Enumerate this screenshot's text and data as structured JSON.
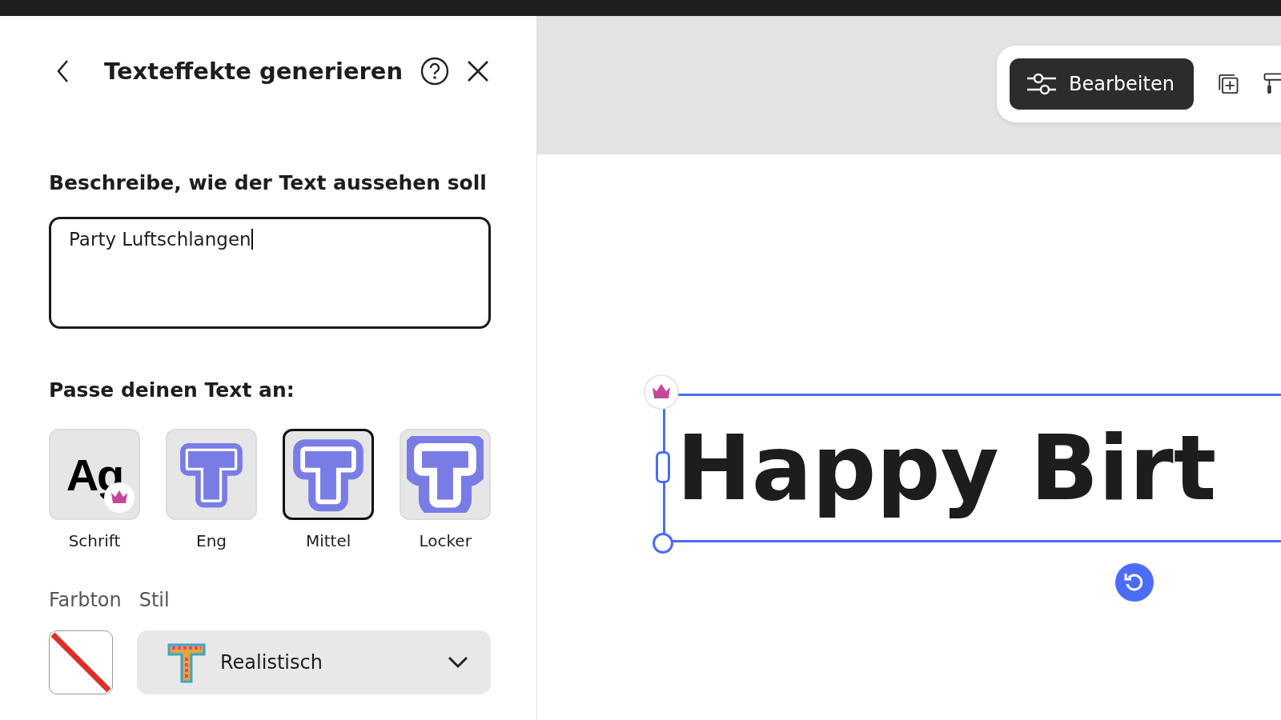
{
  "panel": {
    "title": "Texteffekte generieren",
    "prompt_label": "Beschreibe, wie der Text aussehen soll",
    "prompt": {
      "value": "Party Luftschlangen"
    },
    "adjust_label": "Passe deinen Text an:",
    "shapes": [
      {
        "kind": "font",
        "sample": "Ag",
        "label": "Schrift",
        "selected": false,
        "premium": true
      },
      {
        "kind": "tight",
        "label": "Eng",
        "selected": false
      },
      {
        "kind": "medium",
        "label": "Mittel",
        "selected": true
      },
      {
        "kind": "loose",
        "label": "Locker",
        "selected": false
      }
    ],
    "color_label": "Farbton",
    "style_label": "Stil",
    "color": {
      "none": true
    },
    "style": {
      "value": "Realistisch"
    }
  },
  "toolbar": {
    "edit_button": "Bearbeiten"
  },
  "canvas": {
    "text": "Happy Birt",
    "premium": true
  }
}
